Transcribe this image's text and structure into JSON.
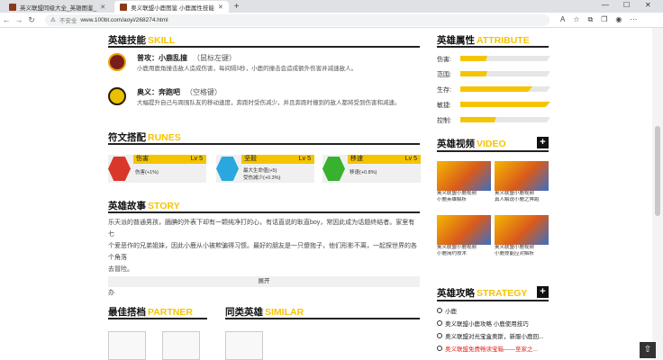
{
  "browser": {
    "tabs": [
      {
        "title": "英义联盟同级大全_英雄图鉴_",
        "active": false
      },
      {
        "title": "奥义联盟小鹿图鉴 小鹿属性技能",
        "active": true
      }
    ],
    "new_tab": "+",
    "security_label": "不安全",
    "url": "www.100bt.com/aoyi/268274.html",
    "window_controls": [
      "—",
      "☐",
      "✕"
    ]
  },
  "skills": {
    "title": "英雄技能",
    "title_en": "SKILL",
    "items": [
      {
        "name": "普攻：小鹿乱撞",
        "key": "（鼠标左键）",
        "desc": "小鹿用鹿角撞击敌人造成伤害，每间隔5秒，小鹿的撞击会造成额外伤害并减速敌人。",
        "icon": "deer-charge-icon"
      },
      {
        "name": "奥义：奔跑吧",
        "key": "（空格键）",
        "desc": "大幅提升自己与周围队友的移动速度，奔跑时受伤减少，并且奔跑时撞到的敌人都将受到伤害和减速。",
        "icon": "run-icon"
      }
    ]
  },
  "runes": {
    "title": "符文搭配",
    "title_en": "RUNES",
    "items": [
      {
        "name": "伤害",
        "level": "Lv 5",
        "effects": [
          "伤害(+1%)"
        ],
        "color": "#d8372a"
      },
      {
        "name": "坚毅",
        "level": "Lv 5",
        "effects": [
          "最大生命值(+5)",
          "受伤减少(+0.3%)"
        ],
        "color": "#2aa7de"
      },
      {
        "name": "移速",
        "level": "Lv 5",
        "effects": [
          "移速(+0.8%)"
        ],
        "color": "#38b12e"
      }
    ]
  },
  "story": {
    "title": "英雄故事",
    "title_en": "STORY",
    "lines": [
      "乐天派的普通男孩，腼腆的外表下却有一颗纯净打的心，有话直说的耿直boy，常因此成为话题终结者。家里有七",
      "个爱恶作的兄弟姐妹，因此小鹿从小被欺骗得习惯。最好的朋友是一只傻狍子，他们形影不离，一起探世界的各个角落",
      "去冒险。",
      "热心的小鹿充满英雄情怀，遇到需要帮助的人时，会毫不犹豫拼命跑到，飞奔过去帮忙。但他害怕不住车得好行办"
    ],
    "expand": "展开"
  },
  "partner": {
    "title": "最佳搭档",
    "title_en": "PARTNER"
  },
  "similar": {
    "title": "同类英雄",
    "title_en": "SIMILAR"
  },
  "attributes": {
    "title": "英雄属性",
    "title_en": "ATTRIBUTE",
    "items": [
      {
        "label": "伤害:",
        "value": 0.3
      },
      {
        "label": "范围:",
        "value": 0.3
      },
      {
        "label": "生存:",
        "value": 0.8
      },
      {
        "label": "敏捷:",
        "value": 1.0
      },
      {
        "label": "控制:",
        "value": 0.4
      }
    ]
  },
  "videos": {
    "title": "英雄视频",
    "title_en": "VIDEO",
    "items": [
      {
        "title": [
          "奥义联盟小鹿视频",
          "小鹿英雄解析"
        ]
      },
      {
        "title": [
          "奥义联盟小鹿视频",
          "真人解说小鹿之奔跑"
        ]
      },
      {
        "title": [
          "奥义联盟小鹿视频",
          "小鹿简约技术"
        ]
      },
      {
        "title": [
          "奥义联盟小鹿视频",
          "小鹿技能应对解析"
        ]
      }
    ]
  },
  "guides": {
    "title": "英雄攻略",
    "title_en": "STRATEGY",
    "items": [
      {
        "text": "小鹿",
        "color": "#222"
      },
      {
        "text": "奥义联盟小鹿攻略 小鹿使用技巧",
        "color": "#222"
      },
      {
        "text": "奥义联盟对光宝盒奥斯，新服小鹿回...",
        "color": "#222"
      },
      {
        "text": "奥义联盟免费畅读宝箱——至家之...",
        "color": "#e1251b"
      }
    ]
  },
  "back_to_top": "⇧"
}
